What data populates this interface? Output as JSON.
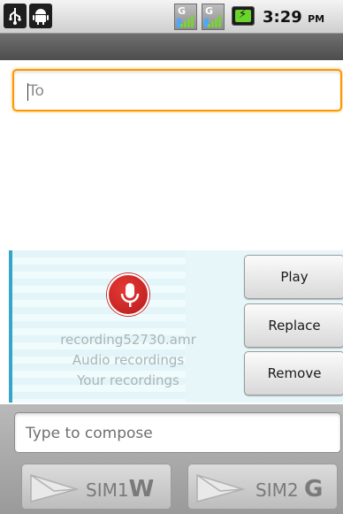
{
  "status_bar": {
    "left_icons": [
      "usb-icon",
      "android-debug-icon"
    ],
    "signal_icons": [
      "signal-g-icon",
      "signal-g-icon"
    ],
    "battery_icon": "battery-charging-icon",
    "time": "3:29",
    "ampm": "PM"
  },
  "compose_header": {
    "to_placeholder": "To"
  },
  "attachment": {
    "icon": "microphone-icon",
    "file_name": "recording52730.amr",
    "line2": "Audio recordings",
    "line3": "Your recordings",
    "buttons": {
      "play": "Play",
      "replace": "Replace",
      "remove": "Remove"
    }
  },
  "composer": {
    "placeholder": "Type to compose",
    "sim1": {
      "label": "SIM1",
      "mark": "W"
    },
    "sim2": {
      "label": "SIM2",
      "mark": "G"
    }
  },
  "colors": {
    "focus_orange": "#ff9800",
    "attachment_bg": "#e6f6f9",
    "attachment_accent": "#35a6c6",
    "mic_red": "#c62828"
  }
}
